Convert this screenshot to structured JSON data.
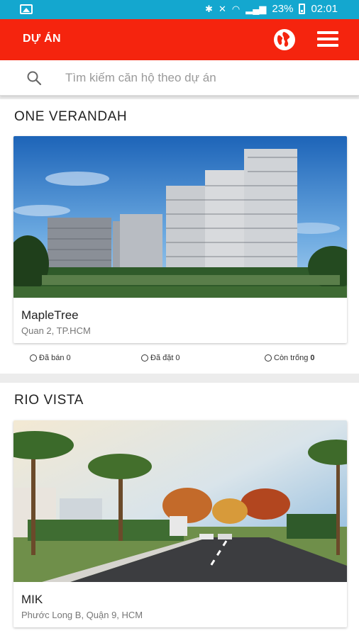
{
  "status_bar": {
    "battery": "23%",
    "time": "02:01"
  },
  "app_bar": {
    "title": "DỰ ÁN",
    "globe_icon": "globe-icon",
    "menu_icon": "hamburger-menu-icon"
  },
  "search": {
    "placeholder": "Tìm kiếm căn hộ theo dự án"
  },
  "projects": [
    {
      "section_title": "ONE VERANDAH",
      "name": "MapleTree",
      "address": "Quan 2, TP.HCM",
      "stats": [
        {
          "label": "Đã bán",
          "value": "0"
        },
        {
          "label": "Đã đặt",
          "value": "0"
        },
        {
          "label": "Còn trống",
          "value": "0"
        }
      ]
    },
    {
      "section_title": "RIO VISTA",
      "name": "MIK",
      "address": "Phước Long B, Quận 9, HCM"
    }
  ],
  "colors": {
    "status_bar": "#14a7cf",
    "app_bar": "#f5240e"
  }
}
